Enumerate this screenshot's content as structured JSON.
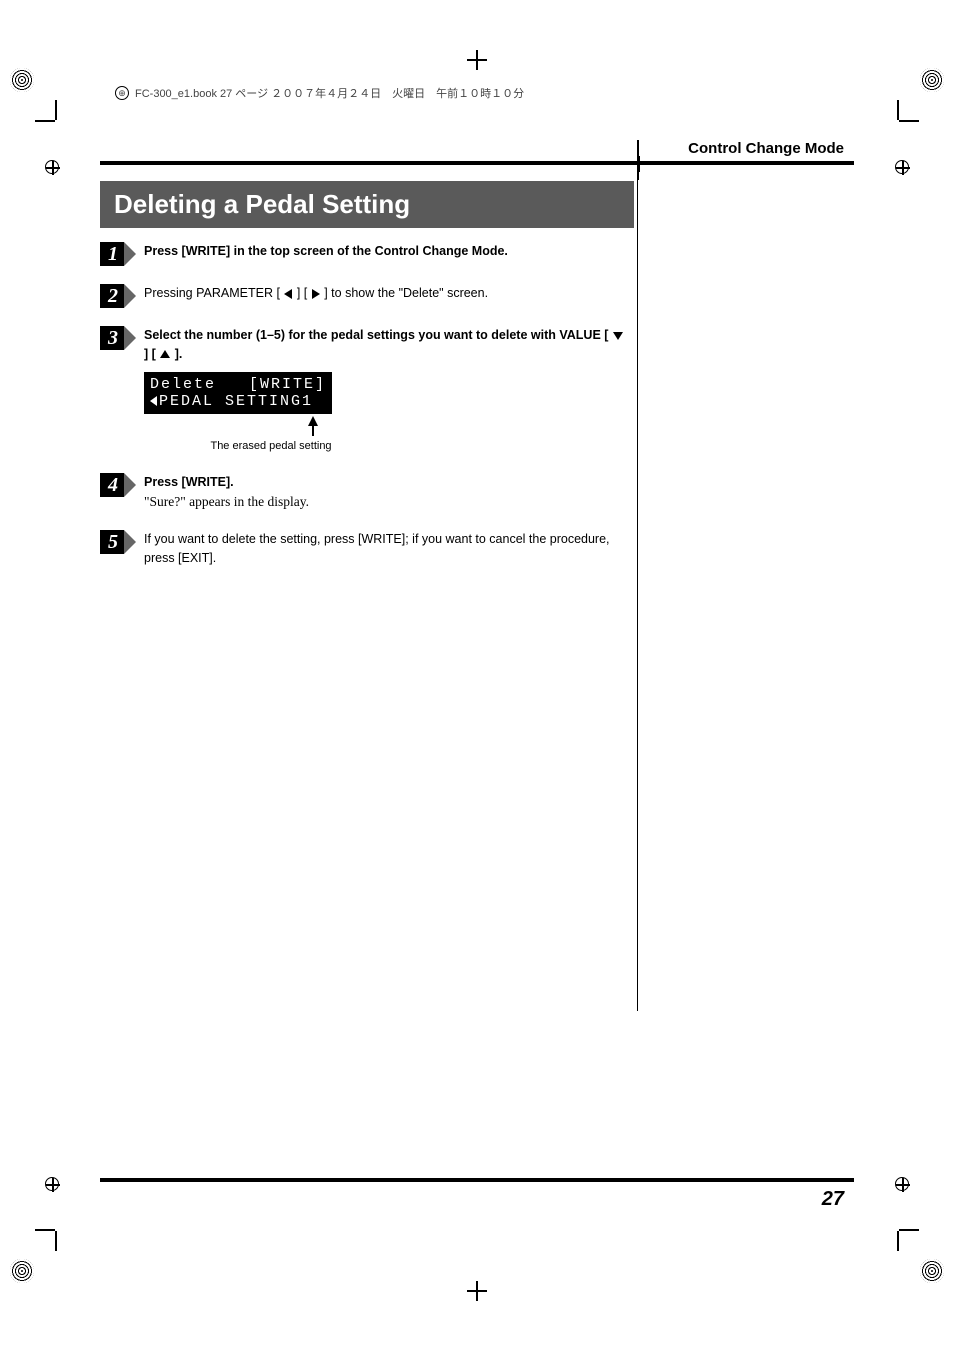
{
  "book_strip": "FC-300_e1.book 27 ページ ２００７年４月２４日　火曜日　午前１０時１０分",
  "book_strip_icon_label": "⊕",
  "running_head": "Control Change Mode",
  "title": "Deleting a Pedal Setting",
  "steps": {
    "s1": {
      "num": "1",
      "text": "Press [WRITE] in the top screen of the Control Change Mode."
    },
    "s2": {
      "num": "2",
      "prefix": "Pressing PARAMETER [ ",
      "mid": " ] [ ",
      "suffix": " ] to show the \"Delete\" screen."
    },
    "s3": {
      "num": "3",
      "prefix": "Select the number (1–5) for the pedal settings you want to delete with VALUE [ ",
      "mid": " ] [ ",
      "suffix": " ].",
      "lcd_line1": "Delete   [WRITE]",
      "lcd_line2": "PEDAL SETTING1",
      "caption": "The erased pedal setting"
    },
    "s4": {
      "num": "4",
      "title": "Press [WRITE].",
      "body": "\"Sure?\" appears in the display."
    },
    "s5": {
      "num": "5",
      "text": "If you want to delete the setting, press [WRITE]; if you want to cancel the procedure, press [EXIT]."
    }
  },
  "page_number": "27"
}
